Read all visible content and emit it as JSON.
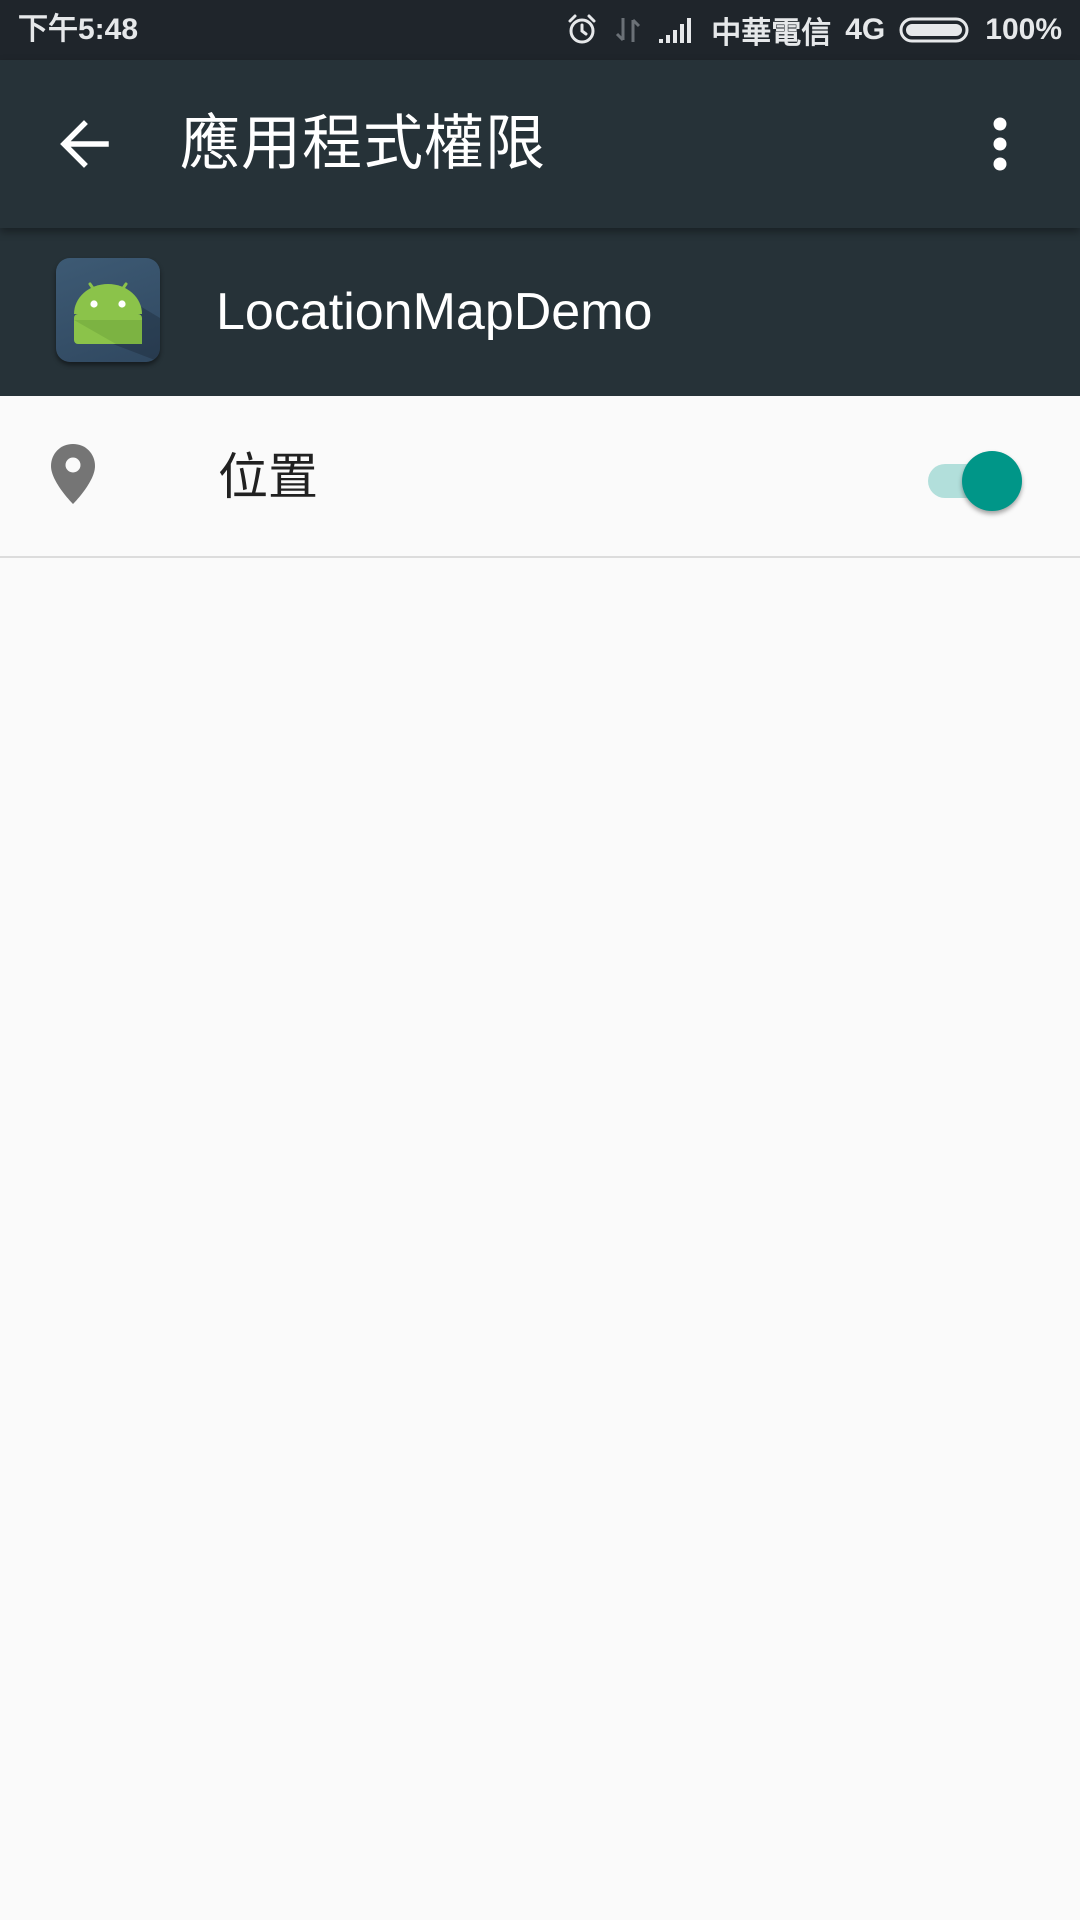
{
  "status_bar": {
    "time": "下午5:48",
    "carrier": "中華電信",
    "network": "4G",
    "battery": "100%",
    "icons": [
      "alarm-icon",
      "data-transfer-icon",
      "signal-icon",
      "battery-icon"
    ]
  },
  "toolbar": {
    "title": "應用程式權限",
    "back_icon": "arrow-back-icon",
    "overflow_icon": "more-vert-icon"
  },
  "app": {
    "name": "LocationMapDemo",
    "icon": "android-icon"
  },
  "permissions": [
    {
      "label": "位置",
      "icon": "location-pin-icon",
      "enabled": true
    }
  ],
  "colors": {
    "status_bar_bg": "#1f252b",
    "toolbar_bg": "#263238",
    "page_bg": "#fafafa",
    "accent": "#009688",
    "accent_track": "#b2dfdb",
    "android_green": "#8bc34a"
  }
}
